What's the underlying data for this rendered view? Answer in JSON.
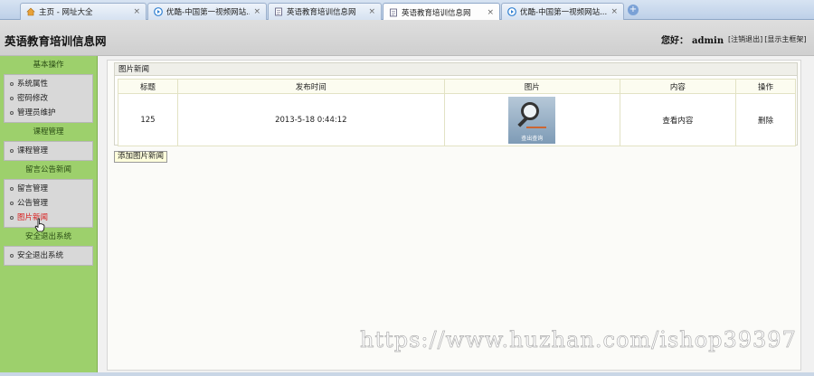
{
  "browser": {
    "tabs": [
      {
        "title": "主页 - 网址大全",
        "icon": "home-icon",
        "active": false
      },
      {
        "title": "优酷-中国第一视频网站...",
        "icon": "youku-icon",
        "active": false
      },
      {
        "title": "英语教育培训信息网",
        "icon": "page-icon",
        "active": false
      },
      {
        "title": "英语教育培训信息网",
        "icon": "page-icon",
        "active": true
      },
      {
        "title": "优酷-中国第一视频网站...",
        "icon": "youku-icon",
        "active": false
      }
    ],
    "close_glyph": "×",
    "new_tab_glyph": "+"
  },
  "header": {
    "site_title": "英语教育培训信息网",
    "greeting": "您好：",
    "username": "admin",
    "logout_link": "[注销退出]",
    "show_frame_link": "[显示主框架]"
  },
  "sidebar": {
    "sections": [
      {
        "title": "基本操作",
        "items": [
          "系统属性",
          "密码修改",
          "管理员维护"
        ]
      },
      {
        "title": "课程管理",
        "items": [
          "课程管理"
        ]
      },
      {
        "title": "留言公告新闻",
        "items": [
          "留言管理",
          "公告管理",
          "图片新闻"
        ]
      },
      {
        "title": "安全退出系统",
        "items": [
          "安全退出系统"
        ]
      }
    ]
  },
  "main": {
    "panel_title": "图片新闻",
    "columns": [
      "标题",
      "发布时间",
      "图片",
      "内容",
      "操作"
    ],
    "rows": [
      {
        "title": "125",
        "time": "2013-5-18 0:44:12",
        "image_caption": "查出查询",
        "content_link": "查看内容",
        "action_link": "删除"
      }
    ],
    "add_button": "添加图片新闻"
  },
  "watermark": "https://www.huzhan.com/ishop39397",
  "colors": {
    "sidebar_bg": "#9dd06c",
    "menu_hover": "#d81e1e",
    "header_bg": "#d6d6d6",
    "add_button_bg": "#ffffdc"
  }
}
